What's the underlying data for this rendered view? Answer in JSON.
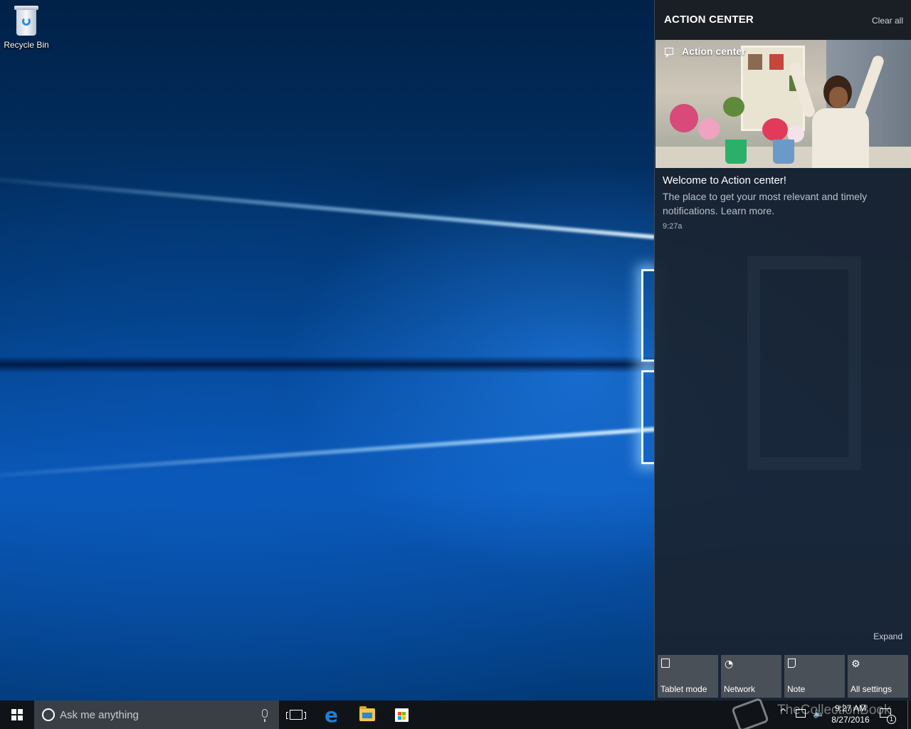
{
  "desktop": {
    "icons": [
      {
        "label": "Recycle Bin",
        "icon": "recycle-bin-icon"
      }
    ]
  },
  "action_center": {
    "title": "ACTION CENTER",
    "clear_all": "Clear all",
    "notification": {
      "app_name": "Action center",
      "title": "Welcome to Action center!",
      "body": "The place to get your most relevant and timely notifications. Learn more.",
      "time": "9:27a"
    },
    "expand": "Expand",
    "quick_actions": [
      {
        "label": "Tablet mode",
        "icon": "tablet-mode-icon"
      },
      {
        "label": "Network",
        "icon": "network-icon"
      },
      {
        "label": "Note",
        "icon": "note-icon"
      },
      {
        "label": "All settings",
        "icon": "gear-icon"
      }
    ]
  },
  "taskbar": {
    "search_placeholder": "Ask me anything",
    "apps": [
      "task-view-icon",
      "edge-icon",
      "file-explorer-icon",
      "store-icon"
    ],
    "watermark": "TheCollectionBook",
    "clock": {
      "time": "9:27 AM",
      "date": "8/27/2016"
    },
    "notification_count": "1"
  },
  "colors": {
    "accent_blue": "#1b7fd9",
    "action_center_bg": "#1a2430",
    "tile_bg": "#4a5058",
    "taskbar_bg": "#101418"
  }
}
